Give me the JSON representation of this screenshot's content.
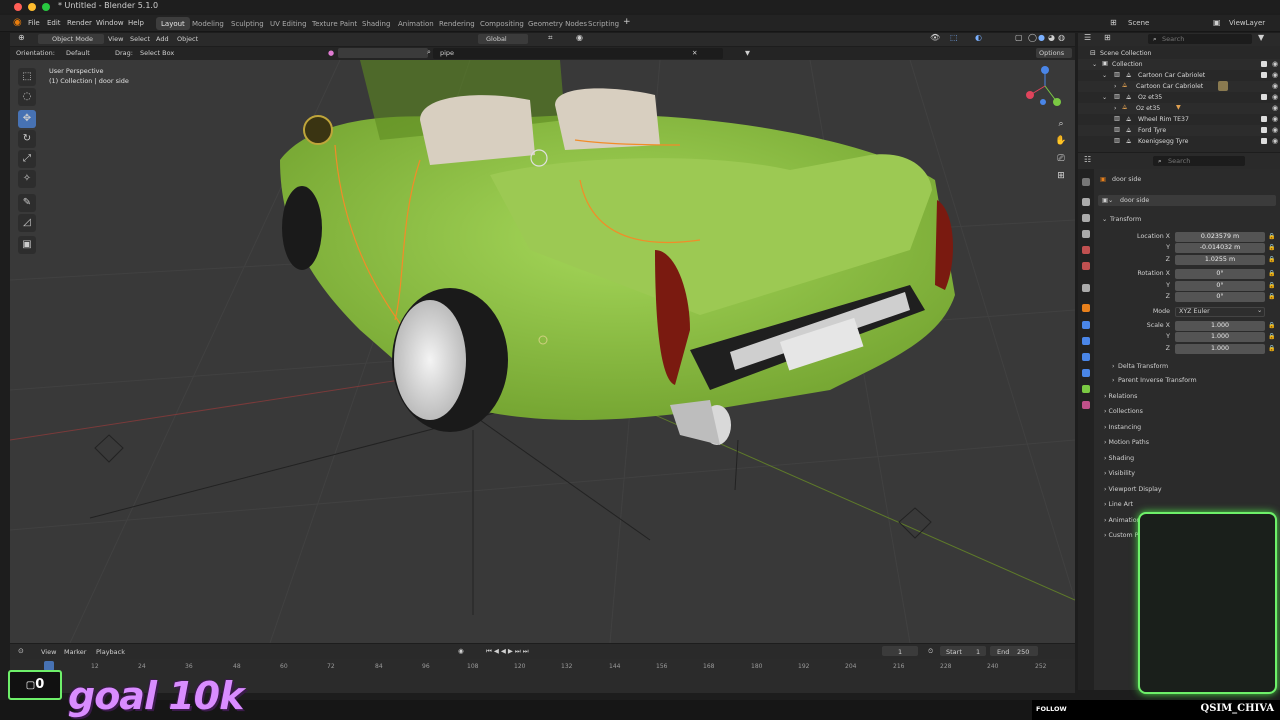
{
  "window": {
    "title": "* Untitled - Blender 5.1.0"
  },
  "menu": {
    "items": [
      "File",
      "Edit",
      "Render",
      "Window",
      "Help"
    ]
  },
  "workspaces": [
    "Layout",
    "Modeling",
    "Sculpting",
    "UV Editing",
    "Texture Paint",
    "Shading",
    "Animation",
    "Rendering",
    "Compositing",
    "Geometry Nodes",
    "Scripting"
  ],
  "scene": {
    "scene_name": "Scene",
    "view_layer": "ViewLayer"
  },
  "viewport_header": {
    "mode": "Object Mode",
    "menus": [
      "View",
      "Select",
      "Add",
      "Object"
    ],
    "transform_orientation": "Global",
    "search_value": "pipe",
    "options": "Options",
    "orientation_label": "Orientation:",
    "orientation_value": "Default",
    "drag_label": "Drag:",
    "drag_value": "Select Box"
  },
  "viewport": {
    "perspective": "User Perspective",
    "collection_info": "(1) Collection | door side"
  },
  "outliner": {
    "search_placeholder": "Search",
    "rows": [
      {
        "label": "Scene Collection",
        "indent": 0
      },
      {
        "label": "Collection",
        "indent": 1
      },
      {
        "label": "Cartoon Car Cabriolet",
        "indent": 2
      },
      {
        "label": "Cartoon Car Cabriolet",
        "indent": 3
      },
      {
        "label": "Oz et35",
        "indent": 2
      },
      {
        "label": "Oz et35",
        "indent": 3
      },
      {
        "label": "Wheel Rim TE37",
        "indent": 2
      },
      {
        "label": "Ford Tyre",
        "indent": 2
      },
      {
        "label": "Koenigsegg Tyre",
        "indent": 2
      }
    ]
  },
  "properties": {
    "search_placeholder": "Search",
    "object_name": "door side",
    "object_field": "door side",
    "transform_title": "Transform",
    "location_label": "Location X",
    "location": [
      "0.023579 m",
      "-0.014032 m",
      "1.0255 m"
    ],
    "rotation_label": "Rotation X",
    "rotation": [
      "0°",
      "0°",
      "0°"
    ],
    "mode_label": "Mode",
    "mode_value": "XYZ Euler",
    "scale_label": "Scale X",
    "scale": [
      "1.000",
      "1.000",
      "1.000"
    ],
    "y_label": "Y",
    "z_label": "Z",
    "subsections": [
      "Delta Transform",
      "Parent Inverse Transform"
    ],
    "sections": [
      "Relations",
      "Collections",
      "Instancing",
      "Motion Paths",
      "Shading",
      "Visibility",
      "Viewport Display",
      "Line Art",
      "Animation",
      "Custom Properties"
    ]
  },
  "timeline": {
    "menus": [
      "View",
      "Marker",
      "Playback"
    ],
    "current_frame": "1",
    "start_label": "Start",
    "start": "1",
    "end_label": "End",
    "end": "250",
    "ticks": [
      "12",
      "24",
      "36",
      "48",
      "60",
      "72",
      "84",
      "96",
      "108",
      "120",
      "132",
      "144",
      "156",
      "168",
      "180",
      "192",
      "204",
      "216",
      "228",
      "240",
      "252"
    ]
  },
  "overlay": {
    "counter": "0",
    "goal_text": "goal 10k",
    "follow_label": "FOLLOW",
    "channel": "QSIM_CHIVA"
  },
  "colors": {
    "car_green": "#8cc63f",
    "selection_orange": "#f28c28",
    "accent_blue": "#4772b3",
    "overlay_green": "#6ef06a",
    "goal_purple": "#d98cff"
  }
}
